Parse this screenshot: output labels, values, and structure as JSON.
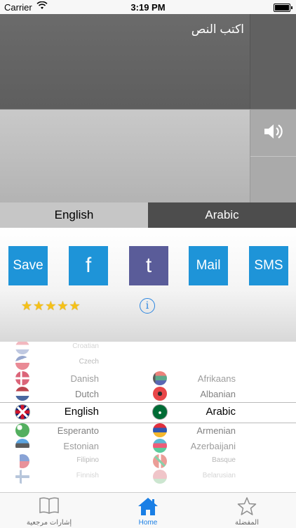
{
  "status_bar": {
    "carrier": "Carrier",
    "time": "3:19 PM"
  },
  "input": {
    "placeholder": "اكتب النص"
  },
  "languages": {
    "from": "English",
    "to": "Arabic"
  },
  "actions": {
    "save": "Save",
    "facebook": "f",
    "tumblr": "t",
    "mail": "Mail",
    "sms": "SMS"
  },
  "rating": {
    "stars": 5,
    "stars_glyphs": "★★★★★"
  },
  "info_glyph": "i",
  "picker": {
    "left_column": [
      {
        "name": "Croatian",
        "flag": "croatia"
      },
      {
        "name": "Czech",
        "flag": "czech"
      },
      {
        "name": "Danish",
        "flag": "denmark"
      },
      {
        "name": "Dutch",
        "flag": "netherlands"
      },
      {
        "name": "English",
        "flag": "uk",
        "selected": true
      },
      {
        "name": "Esperanto",
        "flag": "esperanto"
      },
      {
        "name": "Estonian",
        "flag": "estonia"
      },
      {
        "name": "Filipino",
        "flag": "philippines"
      },
      {
        "name": "Finnish",
        "flag": "finland"
      }
    ],
    "right_column": [
      {
        "name": "Afrikaans",
        "flag": "south-africa"
      },
      {
        "name": "Albanian",
        "flag": "albania"
      },
      {
        "name": "Arabic",
        "flag": "saudi-arabia",
        "selected": true
      },
      {
        "name": "Armenian",
        "flag": "armenia"
      },
      {
        "name": "Azerbaijani",
        "flag": "azerbaijan"
      },
      {
        "name": "Basque",
        "flag": "basque"
      },
      {
        "name": "Belarusian",
        "flag": "belarus"
      }
    ]
  },
  "tabbar": {
    "bookmarks": "إشارات مرجعية",
    "home": "Home",
    "favorites": "المفضلة"
  },
  "colors": {
    "accent": "#1a7fe5",
    "button_blue": "#1e94d8",
    "button_tumblr": "#5a5c99",
    "star": "#f5c118"
  }
}
